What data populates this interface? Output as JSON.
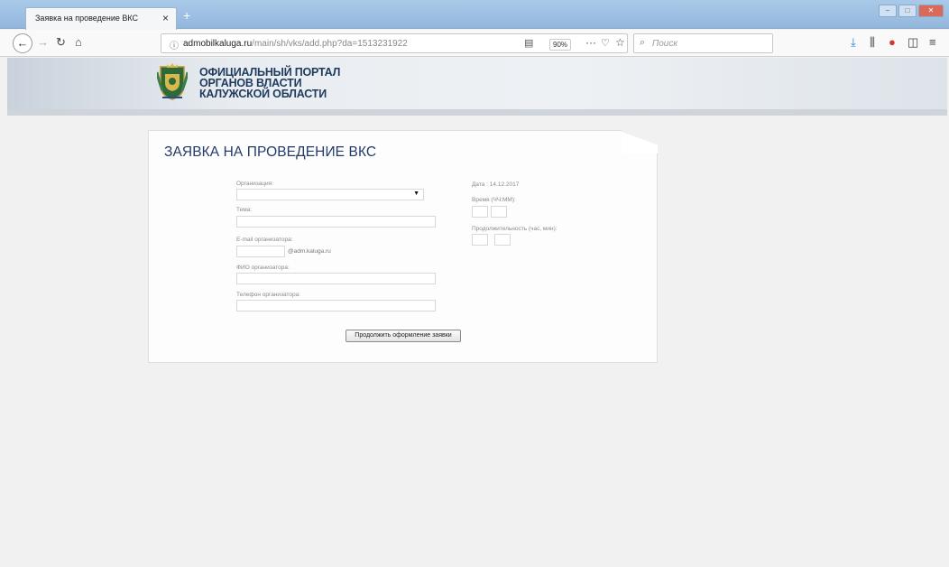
{
  "browser": {
    "tab_title": "Заявка на проведение ВКС",
    "tab_close": "×",
    "new_tab": "+",
    "url_domain": "admobilkaluga.ru",
    "url_path": "/main/sh/vks/add.php?da=1513231922",
    "zoom": "90%",
    "search_placeholder": "Поиск"
  },
  "portal": {
    "title_line1": "ОФИЦИАЛЬНЫЙ ПОРТАЛ",
    "title_line2": "ОРГАНОВ ВЛАСТИ",
    "title_line3": "КАЛУЖСКОЙ ОБЛАСТИ"
  },
  "form": {
    "title": "ЗАЯВКА НА ПРОВЕДЕНИЕ ВКС",
    "organization_label": "Организация:",
    "organization_value": "",
    "topic_label": "Тема:",
    "email_label": "E-mail организатора:",
    "email_domain": "@adm.kaluga.ru",
    "fio_label": "ФИО организатора:",
    "phone_label": "Телефон организатора:",
    "date_label": "Дата : 14.12.2017",
    "time_label": "Время (ЧЧ:ММ):",
    "duration_label": "Продолжительность (час, мин):",
    "submit_label": "Продолжить оформление заявки"
  },
  "colors": {
    "title": "#223b6a",
    "portal_title": "#1e3a5c",
    "tabbar": "#a9c9e8"
  }
}
